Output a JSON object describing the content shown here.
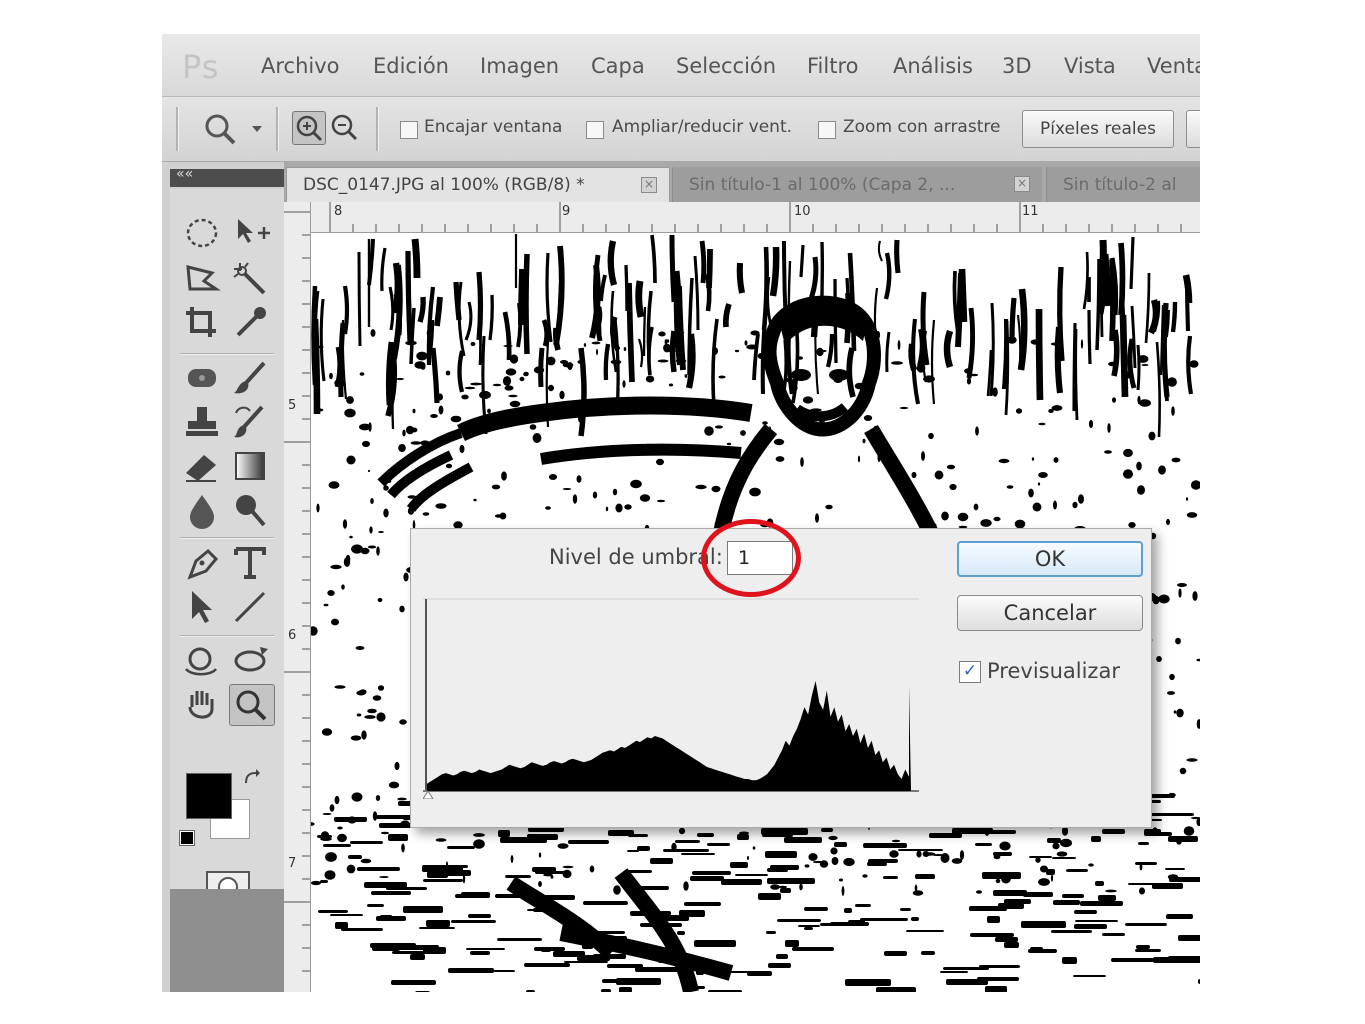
{
  "app": {
    "logo": "Ps",
    "menu": [
      "Archivo",
      "Edición",
      "Imagen",
      "Capa",
      "Selección",
      "Filtro",
      "Análisis",
      "3D",
      "Vista",
      "Venta"
    ]
  },
  "options_bar": {
    "checkbox_fit_window": "Encajar ventana",
    "checkbox_resize_windows": "Ampliar/reducir vent.",
    "checkbox_scrubby_zoom": "Zoom con arrastre",
    "actual_pixels_button": "Píxeles reales"
  },
  "panel": {
    "collapse_glyph": "««"
  },
  "tabs": [
    {
      "label": "DSC_0147.JPG al 100% (RGB/8) *",
      "active": true
    },
    {
      "label": "Sin título-1 al 100% (Capa 2, ...",
      "active": false
    },
    {
      "label": "Sin título-2 al",
      "active": false
    }
  ],
  "rulers": {
    "top": [
      "8",
      "9",
      "10",
      "11"
    ],
    "left": [
      "5",
      "6",
      "7"
    ]
  },
  "dialog": {
    "threshold_label": "Nivel de umbral:",
    "threshold_value": "1",
    "ok_label": "OK",
    "cancel_label": "Cancelar",
    "preview_label": "Previsualizar",
    "preview_checked": true,
    "histogram": [
      6,
      8,
      10,
      12,
      14,
      15,
      14,
      13,
      14,
      16,
      17,
      16,
      15,
      16,
      18,
      17,
      16,
      15,
      16,
      17,
      18,
      20,
      22,
      21,
      20,
      19,
      20,
      22,
      24,
      23,
      22,
      21,
      22,
      24,
      25,
      24,
      23,
      24,
      26,
      27,
      26,
      25,
      24,
      25,
      26,
      28,
      30,
      32,
      33,
      34,
      33,
      35,
      37,
      36,
      38,
      40,
      42,
      41,
      43,
      45,
      44,
      46,
      45,
      44,
      42,
      40,
      38,
      36,
      34,
      32,
      30,
      28,
      26,
      24,
      22,
      20,
      19,
      18,
      17,
      16,
      15,
      14,
      13,
      12,
      11,
      10,
      10,
      9,
      9,
      10,
      12,
      14,
      18,
      22,
      28,
      34,
      42,
      38,
      46,
      52,
      60,
      70,
      64,
      80,
      92,
      74,
      68,
      84,
      62,
      70,
      58,
      64,
      50,
      56,
      46,
      52,
      40,
      48,
      36,
      42,
      30,
      34,
      24,
      28,
      18,
      22,
      14,
      10,
      18,
      12
    ]
  },
  "colors": {
    "highlight_circle": "#e0121b",
    "ok_border": "#5f9fd0",
    "foreground_swatch": "#000000",
    "background_swatch": "#ffffff"
  }
}
